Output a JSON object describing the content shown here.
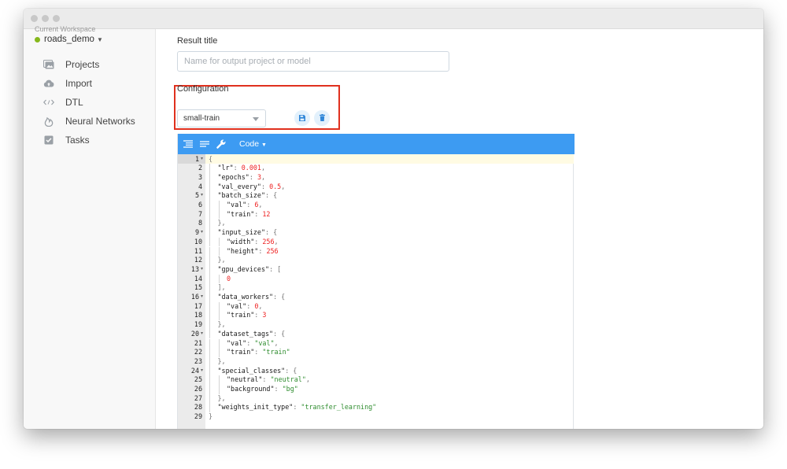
{
  "sidebar": {
    "workspace_caption": "Current Workspace",
    "workspace_name": "roads_demo",
    "workspace_color": "#86b81c",
    "items": [
      {
        "label": "Projects",
        "icon": "projects-icon"
      },
      {
        "label": "Import",
        "icon": "cloud-upload-icon"
      },
      {
        "label": "DTL",
        "icon": "code-brackets-icon"
      },
      {
        "label": "Neural Networks",
        "icon": "neural-network-icon"
      },
      {
        "label": "Tasks",
        "icon": "checkbox-icon"
      }
    ]
  },
  "main": {
    "result_title_label": "Result title",
    "result_title_placeholder": "Name for output project or model",
    "result_title_value": "",
    "configuration_label": "Configuration",
    "configuration_selected": "small-train",
    "save_icon": "save-icon",
    "delete_icon": "trash-icon",
    "highlight_color": "#e0301e"
  },
  "editor": {
    "toolbar_color": "#3d9bf2",
    "mode_label": "Code",
    "toolbar_icons": [
      "format-icon",
      "compact-icon",
      "wrench-icon"
    ],
    "lines": [
      {
        "n": "1",
        "fold": true,
        "indent": 0,
        "tokens": [
          [
            "p",
            "{"
          ]
        ]
      },
      {
        "n": "2",
        "indent": 1,
        "tokens": [
          [
            "k",
            "\"lr\""
          ],
          [
            "p",
            ": "
          ],
          [
            "n",
            "0.001"
          ],
          [
            "p",
            ","
          ]
        ]
      },
      {
        "n": "3",
        "indent": 1,
        "tokens": [
          [
            "k",
            "\"epochs\""
          ],
          [
            "p",
            ": "
          ],
          [
            "n",
            "3"
          ],
          [
            "p",
            ","
          ]
        ]
      },
      {
        "n": "4",
        "indent": 1,
        "tokens": [
          [
            "k",
            "\"val_every\""
          ],
          [
            "p",
            ": "
          ],
          [
            "n",
            "0.5"
          ],
          [
            "p",
            ","
          ]
        ]
      },
      {
        "n": "5",
        "fold": true,
        "indent": 1,
        "tokens": [
          [
            "k",
            "\"batch_size\""
          ],
          [
            "p",
            ": {"
          ]
        ]
      },
      {
        "n": "6",
        "indent": 2,
        "tokens": [
          [
            "k",
            "\"val\""
          ],
          [
            "p",
            ": "
          ],
          [
            "n",
            "6"
          ],
          [
            "p",
            ","
          ]
        ]
      },
      {
        "n": "7",
        "indent": 2,
        "tokens": [
          [
            "k",
            "\"train\""
          ],
          [
            "p",
            ": "
          ],
          [
            "n",
            "12"
          ]
        ]
      },
      {
        "n": "8",
        "indent": 1,
        "tokens": [
          [
            "p",
            "},"
          ]
        ]
      },
      {
        "n": "9",
        "fold": true,
        "indent": 1,
        "tokens": [
          [
            "k",
            "\"input_size\""
          ],
          [
            "p",
            ": {"
          ]
        ]
      },
      {
        "n": "10",
        "indent": 2,
        "tokens": [
          [
            "k",
            "\"width\""
          ],
          [
            "p",
            ": "
          ],
          [
            "n",
            "256"
          ],
          [
            "p",
            ","
          ]
        ]
      },
      {
        "n": "11",
        "indent": 2,
        "tokens": [
          [
            "k",
            "\"height\""
          ],
          [
            "p",
            ": "
          ],
          [
            "n",
            "256"
          ]
        ]
      },
      {
        "n": "12",
        "indent": 1,
        "tokens": [
          [
            "p",
            "},"
          ]
        ]
      },
      {
        "n": "13",
        "fold": true,
        "indent": 1,
        "tokens": [
          [
            "k",
            "\"gpu_devices\""
          ],
          [
            "p",
            ": ["
          ]
        ]
      },
      {
        "n": "14",
        "indent": 2,
        "tokens": [
          [
            "n",
            "0"
          ]
        ]
      },
      {
        "n": "15",
        "indent": 1,
        "tokens": [
          [
            "p",
            "],"
          ]
        ]
      },
      {
        "n": "16",
        "fold": true,
        "indent": 1,
        "tokens": [
          [
            "k",
            "\"data_workers\""
          ],
          [
            "p",
            ": {"
          ]
        ]
      },
      {
        "n": "17",
        "indent": 2,
        "tokens": [
          [
            "k",
            "\"val\""
          ],
          [
            "p",
            ": "
          ],
          [
            "n",
            "0"
          ],
          [
            "p",
            ","
          ]
        ]
      },
      {
        "n": "18",
        "indent": 2,
        "tokens": [
          [
            "k",
            "\"train\""
          ],
          [
            "p",
            ": "
          ],
          [
            "n",
            "3"
          ]
        ]
      },
      {
        "n": "19",
        "indent": 1,
        "tokens": [
          [
            "p",
            "},"
          ]
        ]
      },
      {
        "n": "20",
        "fold": true,
        "indent": 1,
        "tokens": [
          [
            "k",
            "\"dataset_tags\""
          ],
          [
            "p",
            ": {"
          ]
        ]
      },
      {
        "n": "21",
        "indent": 2,
        "tokens": [
          [
            "k",
            "\"val\""
          ],
          [
            "p",
            ": "
          ],
          [
            "s",
            "\"val\""
          ],
          [
            "p",
            ","
          ]
        ]
      },
      {
        "n": "22",
        "indent": 2,
        "tokens": [
          [
            "k",
            "\"train\""
          ],
          [
            "p",
            ": "
          ],
          [
            "s",
            "\"train\""
          ]
        ]
      },
      {
        "n": "23",
        "indent": 1,
        "tokens": [
          [
            "p",
            "},"
          ]
        ]
      },
      {
        "n": "24",
        "fold": true,
        "indent": 1,
        "tokens": [
          [
            "k",
            "\"special_classes\""
          ],
          [
            "p",
            ": {"
          ]
        ]
      },
      {
        "n": "25",
        "indent": 2,
        "tokens": [
          [
            "k",
            "\"neutral\""
          ],
          [
            "p",
            ": "
          ],
          [
            "s",
            "\"neutral\""
          ],
          [
            "p",
            ","
          ]
        ]
      },
      {
        "n": "26",
        "indent": 2,
        "tokens": [
          [
            "k",
            "\"background\""
          ],
          [
            "p",
            ": "
          ],
          [
            "s",
            "\"bg\""
          ]
        ]
      },
      {
        "n": "27",
        "indent": 1,
        "tokens": [
          [
            "p",
            "},"
          ]
        ]
      },
      {
        "n": "28",
        "indent": 1,
        "tokens": [
          [
            "k",
            "\"weights_init_type\""
          ],
          [
            "p",
            ": "
          ],
          [
            "s",
            "\"transfer_learning\""
          ]
        ]
      },
      {
        "n": "29",
        "indent": 0,
        "tokens": [
          [
            "p",
            "}"
          ]
        ]
      }
    ]
  }
}
